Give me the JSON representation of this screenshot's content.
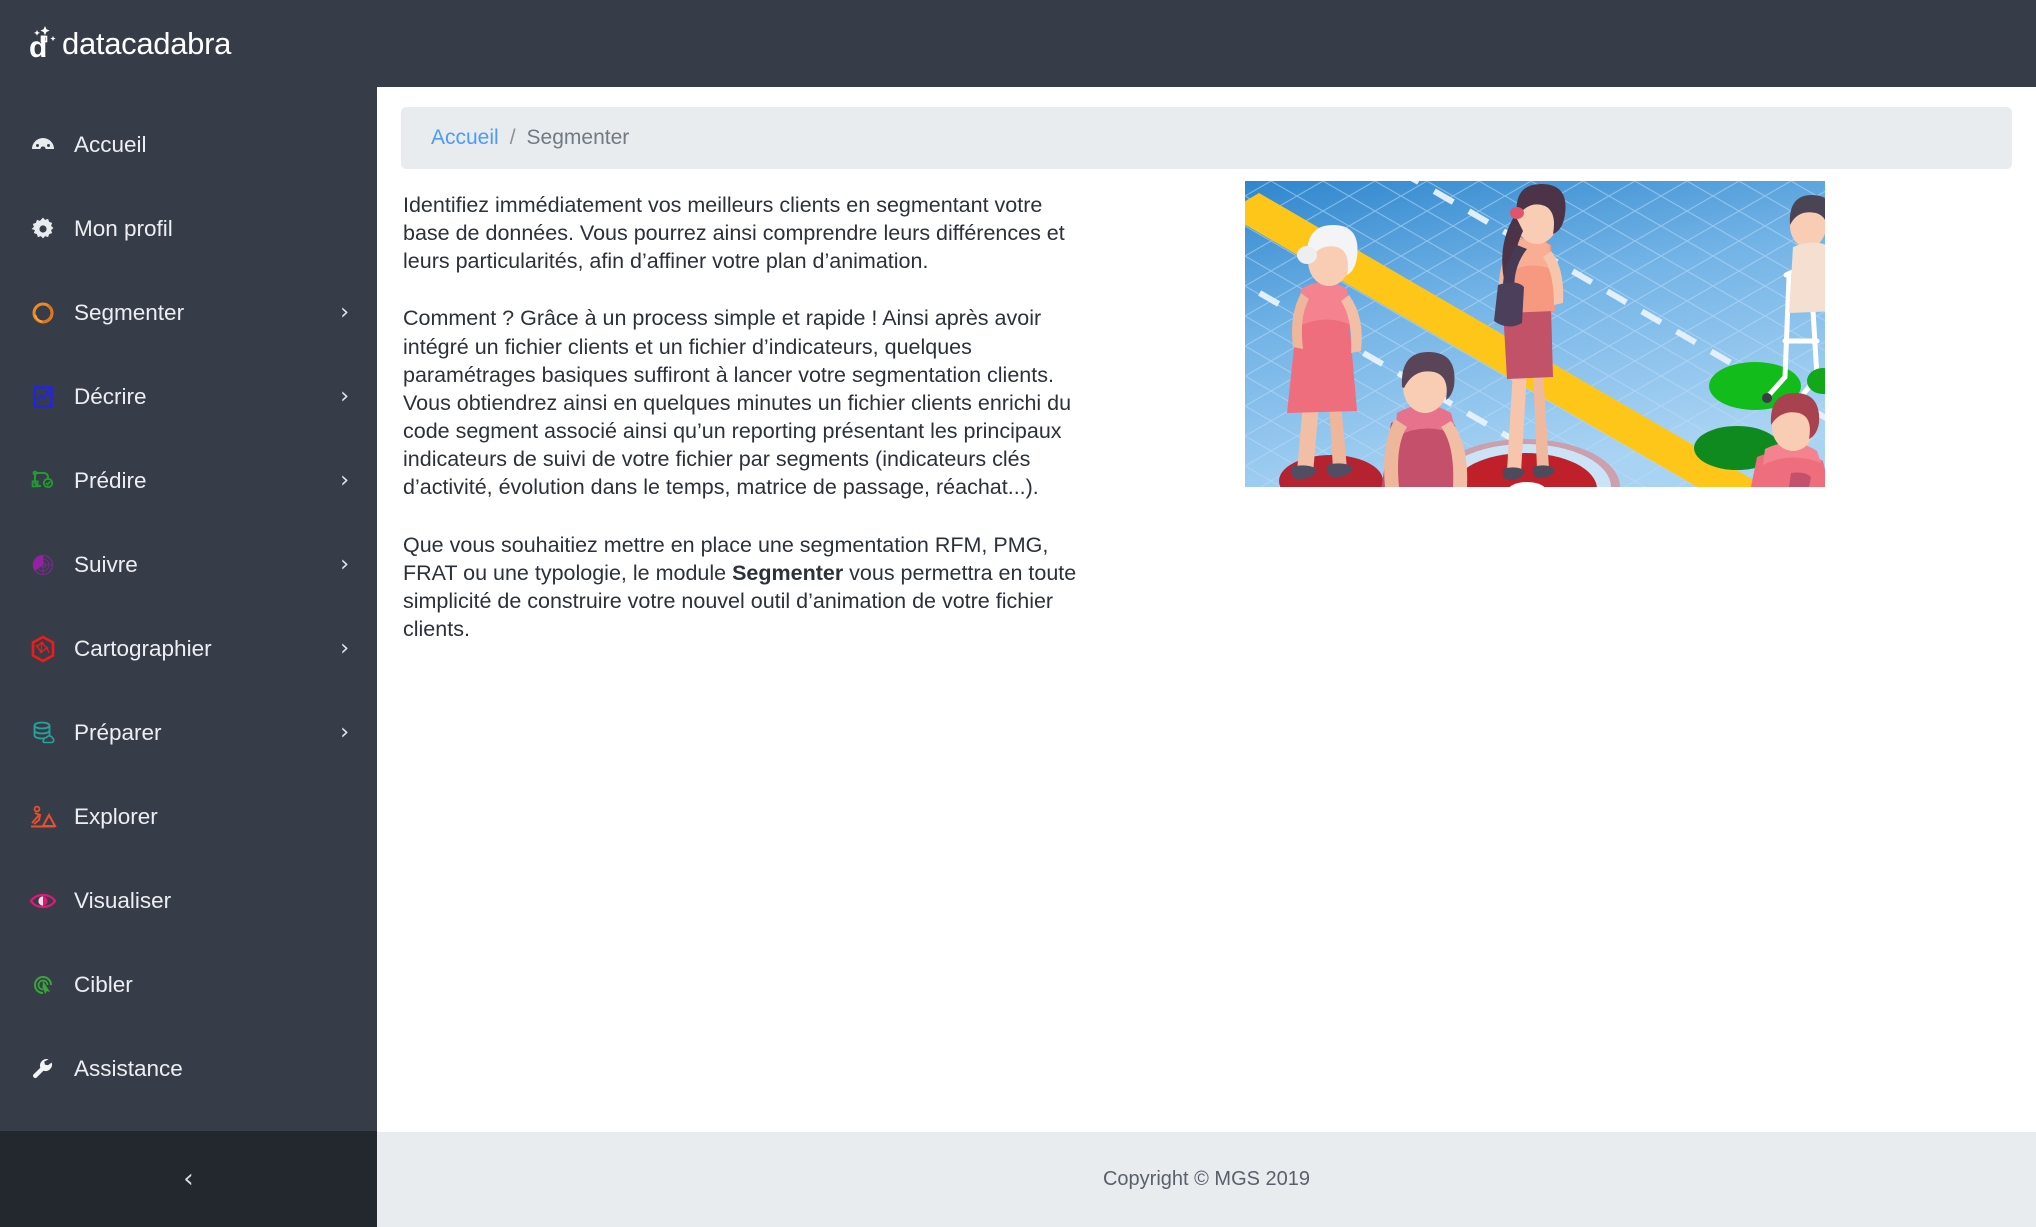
{
  "brand": {
    "name": "datacadabra",
    "logo_icon": "magic-wand-d-logo"
  },
  "sidebar": {
    "items": [
      {
        "label": "Accueil",
        "icon": "dashboard-gauge-icon",
        "color": "#e9ecef",
        "chevron": ""
      },
      {
        "label": "Mon profil",
        "icon": "gear-icon",
        "color": "#e9ecef",
        "chevron": ""
      },
      {
        "label": "Segmenter",
        "icon": "segment-circle-icon",
        "color": "#f08a1e",
        "chevron": "›"
      },
      {
        "label": "Décrire",
        "icon": "chart-document-icon",
        "color": "#2323e8",
        "chevron": "›"
      },
      {
        "label": "Prédire",
        "icon": "decision-tree-icon",
        "color": "#1f9e2f",
        "chevron": "›"
      },
      {
        "label": "Suivre",
        "icon": "radar-icon",
        "color": "#a01fb0",
        "chevron": "›"
      },
      {
        "label": "Cartographier",
        "icon": "hexagon-map-icon",
        "color": "#f01a1a",
        "chevron": "›"
      },
      {
        "label": "Préparer",
        "icon": "database-cloud-icon",
        "color": "#27a39b",
        "chevron": "›"
      },
      {
        "label": "Explorer",
        "icon": "excavate-dig-icon",
        "color": "#e8502a",
        "chevron": ""
      },
      {
        "label": "Visualiser",
        "icon": "eye-icon",
        "color": "#e0187a",
        "chevron": ""
      },
      {
        "label": "Cibler",
        "icon": "target-cursor-icon",
        "color": "#3aa63a",
        "chevron": ""
      },
      {
        "label": "Assistance",
        "icon": "wrench-icon",
        "color": "#f2f4f6",
        "chevron": ""
      }
    ],
    "collapse_icon": "chevron-left-icon"
  },
  "breadcrumb": {
    "home": "Accueil",
    "separator": "/",
    "current": "Segmenter"
  },
  "content": {
    "paragraph_1": "Identifiez immédiatement vos meilleurs clients en segmentant votre base de données. Vous pourrez ainsi comprendre leurs différences et leurs particularités, afin d’affiner votre plan d’animation.",
    "paragraph_2": "Comment ? Grâce à un process simple et rapide ! Ainsi après avoir intégré un fichier clients et un fichier d’indicateurs, quelques paramétrages basiques suffiront à lancer votre segmentation clients. Vous obtiendrez ainsi en quelques minutes un fichier clients enrichi du code segment associé ainsi qu’un reporting présentant les principaux indicateurs de suivi de votre fichier par segments (indicateurs clés d’activité, évolution dans le temps, matrice de passage, réachat...).",
    "paragraph_3_before": "Que vous souhaitiez mettre en place une segmentation RFM, PMG, FRAT ou une typologie, le module ",
    "paragraph_3_bold": "Segmenter",
    "paragraph_3_after": " vous permettra en toute simplicité de construire votre nouvel outil d’animation de votre fichier clients.",
    "illustration_alt": "isometric-people-on-targets-illustration"
  },
  "footer": {
    "copyright": "Copyright © MGS 2019"
  },
  "colors": {
    "sidebar_bg": "#373d48",
    "sidebar_footer_bg": "#23272e",
    "breadcrumb_bg": "#e9ecef",
    "link": "#4a9cf6",
    "text": "#2b3138",
    "page_footer_bg": "#e9ecef"
  }
}
